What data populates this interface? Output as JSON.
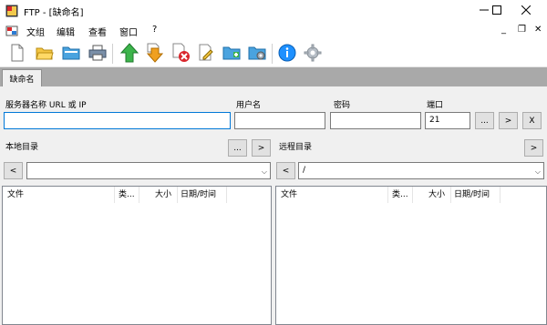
{
  "window": {
    "title": "FTP - [缺命名]",
    "minimize_icon": "minimize-icon",
    "maximize_icon": "maximize-icon",
    "close_icon": "close-icon"
  },
  "menu": {
    "items": [
      "文组",
      "编辑",
      "查看",
      "窗口",
      "?"
    ],
    "mdi_controls": [
      "_",
      "❐",
      "✕"
    ]
  },
  "toolbar": {
    "icons": [
      "new-file-icon",
      "open-folder-icon",
      "folder-icon",
      "print-icon",
      "upload-icon",
      "download-icon",
      "delete-icon",
      "edit-icon",
      "new-folder-icon",
      "folder-settings-icon",
      "info-icon",
      "settings-icon"
    ]
  },
  "tab": {
    "label": "缺命名"
  },
  "connection": {
    "server_label": "服务器名称 URL 或 IP",
    "server_value": "",
    "user_label": "用户名",
    "user_value": "",
    "password_label": "密码",
    "password_value": "",
    "port_label": "端口",
    "port_value": "21",
    "more_button": "...",
    "connect_button": ">",
    "disconnect_button": "X"
  },
  "local": {
    "label": "本地目录",
    "browse_button": "...",
    "go_button": ">",
    "back_button": "<",
    "path_value": "",
    "columns": [
      "文件",
      "类...",
      "大小",
      "日期/时间"
    ]
  },
  "remote": {
    "label": "远程目录",
    "go_button": ">",
    "back_button": "<",
    "path_value": "/",
    "columns": [
      "文件",
      "类...",
      "大小",
      "日期/时间"
    ]
  },
  "colors": {
    "tabstrip": "#a9a9a9",
    "focus_border": "#0078d7",
    "info_blue": "#1e90ff",
    "upload_green": "#3cb44b",
    "download_orange": "#f0a020",
    "delete_red": "#d9262c"
  }
}
